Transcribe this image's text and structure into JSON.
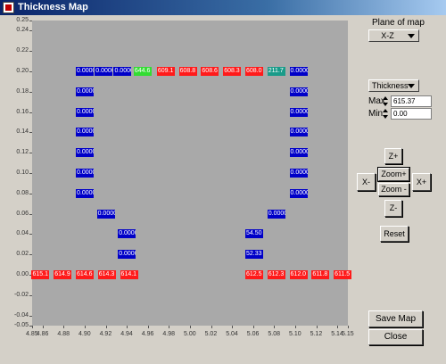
{
  "window": {
    "title": "Thickness Map"
  },
  "controls": {
    "plane_label": "Plane of map",
    "plane_value": "X-Z",
    "quantity_value": "Thickness",
    "max_label": "Max",
    "max_value": "615.37",
    "min_label": "Min",
    "min_value": "0.00",
    "zoom_plus_z": "Z+",
    "zoom_in": "Zoom+",
    "zoom_out": "Zoom -",
    "x_minus": "X-",
    "x_plus": "X+",
    "z_minus": "Z-",
    "reset": "Reset",
    "save_map": "Save Map",
    "close": "Close"
  },
  "chart_data": {
    "type": "heatmap",
    "xlim": [
      4.85,
      5.15
    ],
    "ylim": [
      -0.05,
      0.25
    ],
    "x_ticks": [
      "4.85",
      "4.86",
      "4.88",
      "4.90",
      "4.92",
      "4.94",
      "4.96",
      "4.98",
      "5.00",
      "5.02",
      "5.04",
      "5.06",
      "5.08",
      "5.10",
      "5.12",
      "5.14",
      "5.15"
    ],
    "y_ticks": [
      "0.25",
      "0.24",
      "0.22",
      "0.20",
      "0.18",
      "0.16",
      "0.14",
      "0.12",
      "0.10",
      "0.08",
      "0.06",
      "0.04",
      "0.02",
      "0.00",
      "-0.02",
      "-0.04",
      "-0.05"
    ],
    "cells": [
      {
        "x": 4.9,
        "y": 0.2,
        "label": "0.0000",
        "color": "blue"
      },
      {
        "x": 4.918,
        "y": 0.2,
        "label": "0.0000",
        "color": "blue"
      },
      {
        "x": 4.936,
        "y": 0.2,
        "label": "0.0000",
        "color": "blue"
      },
      {
        "x": 4.955,
        "y": 0.2,
        "label": "644.6",
        "color": "green"
      },
      {
        "x": 4.977,
        "y": 0.2,
        "label": "609.1",
        "color": "red"
      },
      {
        "x": 4.998,
        "y": 0.2,
        "label": "608.8",
        "color": "red"
      },
      {
        "x": 5.019,
        "y": 0.2,
        "label": "608.6",
        "color": "red"
      },
      {
        "x": 5.04,
        "y": 0.2,
        "label": "608.3",
        "color": "red"
      },
      {
        "x": 5.061,
        "y": 0.2,
        "label": "608.0",
        "color": "red"
      },
      {
        "x": 5.082,
        "y": 0.2,
        "label": "211.7",
        "color": "teal"
      },
      {
        "x": 5.103,
        "y": 0.2,
        "label": "0.0000",
        "color": "blue"
      },
      {
        "x": 4.9,
        "y": 0.18,
        "label": "0.0000",
        "color": "blue"
      },
      {
        "x": 5.103,
        "y": 0.18,
        "label": "0.0000",
        "color": "blue"
      },
      {
        "x": 4.9,
        "y": 0.16,
        "label": "0.0000",
        "color": "blue"
      },
      {
        "x": 5.103,
        "y": 0.16,
        "label": "0.0000",
        "color": "blue"
      },
      {
        "x": 4.9,
        "y": 0.14,
        "label": "0.0000",
        "color": "blue"
      },
      {
        "x": 5.103,
        "y": 0.14,
        "label": "0.0000",
        "color": "blue"
      },
      {
        "x": 4.9,
        "y": 0.12,
        "label": "0.0000",
        "color": "blue"
      },
      {
        "x": 5.103,
        "y": 0.12,
        "label": "0.0000",
        "color": "blue"
      },
      {
        "x": 4.9,
        "y": 0.1,
        "label": "0.0000",
        "color": "blue"
      },
      {
        "x": 5.103,
        "y": 0.1,
        "label": "0.0000",
        "color": "blue"
      },
      {
        "x": 4.9,
        "y": 0.08,
        "label": "0.0000",
        "color": "blue"
      },
      {
        "x": 5.103,
        "y": 0.08,
        "label": "0.0000",
        "color": "blue"
      },
      {
        "x": 4.92,
        "y": 0.06,
        "label": "0.0000",
        "color": "blue"
      },
      {
        "x": 5.082,
        "y": 0.06,
        "label": "0.0000",
        "color": "blue"
      },
      {
        "x": 4.94,
        "y": 0.04,
        "label": "0.0000",
        "color": "blue"
      },
      {
        "x": 5.061,
        "y": 0.04,
        "label": "54.50",
        "color": "blue"
      },
      {
        "x": 4.94,
        "y": 0.02,
        "label": "0.0000",
        "color": "blue"
      },
      {
        "x": 5.061,
        "y": 0.02,
        "label": "52.33",
        "color": "blue"
      },
      {
        "x": 4.858,
        "y": 0.0,
        "label": "615.1",
        "color": "red"
      },
      {
        "x": 4.879,
        "y": 0.0,
        "label": "614.9",
        "color": "red"
      },
      {
        "x": 4.9,
        "y": 0.0,
        "label": "614.6",
        "color": "red"
      },
      {
        "x": 4.921,
        "y": 0.0,
        "label": "614.3",
        "color": "red"
      },
      {
        "x": 4.942,
        "y": 0.0,
        "label": "614.1",
        "color": "red"
      },
      {
        "x": 5.061,
        "y": 0.0,
        "label": "612.5",
        "color": "red"
      },
      {
        "x": 5.082,
        "y": 0.0,
        "label": "612.3",
        "color": "red"
      },
      {
        "x": 5.103,
        "y": 0.0,
        "label": "612.0",
        "color": "red"
      },
      {
        "x": 5.124,
        "y": 0.0,
        "label": "611.8",
        "color": "red"
      },
      {
        "x": 5.145,
        "y": 0.0,
        "label": "611.5",
        "color": "red"
      }
    ]
  }
}
